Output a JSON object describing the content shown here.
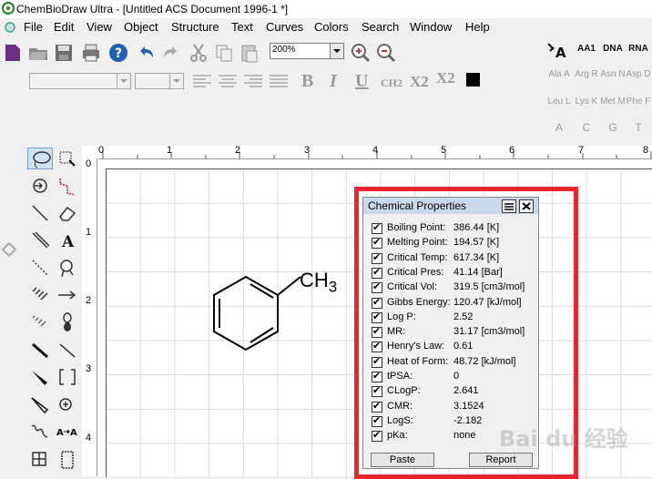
{
  "window": {
    "title": "ChemBioDraw Ultra - [Untitled ACS Document 1996-1 *]"
  },
  "menu": [
    "File",
    "Edit",
    "View",
    "Object",
    "Structure",
    "Text",
    "Curves",
    "Colors",
    "Search",
    "Window",
    "Help"
  ],
  "toolbar": {
    "zoom": "200%"
  },
  "format": {
    "ch2": "CH2",
    "x2": "X2",
    "x_sup": "X2",
    "bold": "B",
    "italic": "I",
    "underline": "U"
  },
  "bio_buttons": [
    [
      "AA1",
      "DNA",
      "RNA"
    ],
    [
      "Ala A",
      "Arg R",
      "Asn N",
      "Asp D"
    ],
    [
      "Leu L",
      "Lys K",
      "Met M",
      "Phe F"
    ],
    [
      "A",
      "C",
      "G",
      "T"
    ]
  ],
  "rulers": {
    "top": [
      "0",
      "1",
      "2",
      "3",
      "4",
      "5",
      "6",
      "7",
      "8"
    ],
    "left": [
      "0",
      "1",
      "2",
      "3",
      "4"
    ]
  },
  "molecule": {
    "label": "CH",
    "subscript": "3"
  },
  "properties_panel": {
    "title": "Chemical Properties",
    "rows": [
      {
        "label": "Boiling Point:",
        "value": "386.44 [K]"
      },
      {
        "label": "Melting Point:",
        "value": "194.57 [K]"
      },
      {
        "label": "Critical Temp:",
        "value": "617.34 [K]"
      },
      {
        "label": "Critical Pres:",
        "value": "41.14 [Bar]"
      },
      {
        "label": "Critical Vol:",
        "value": "319.5 [cm3/mol]"
      },
      {
        "label": "Gibbs Energy:",
        "value": "120.47 [kJ/mol]"
      },
      {
        "label": "Log P:",
        "value": "2.52"
      },
      {
        "label": "MR:",
        "value": "31.17 [cm3/mol]"
      },
      {
        "label": "Henry's Law:",
        "value": "0.61"
      },
      {
        "label": "Heat of Form:",
        "value": "48.72 [kJ/mol]"
      },
      {
        "label": "tPSA:",
        "value": "0"
      },
      {
        "label": "CLogP:",
        "value": "2.641"
      },
      {
        "label": "CMR:",
        "value": "3.1524"
      },
      {
        "label": "LogS:",
        "value": "-2.182"
      },
      {
        "label": "pKa:",
        "value": "none"
      }
    ],
    "paste_label": "Paste",
    "report_label": "Report"
  },
  "watermark": "Bai du 经验",
  "colors": {
    "highlight": "#e8262b",
    "panel_title": "#c9d9ee"
  }
}
